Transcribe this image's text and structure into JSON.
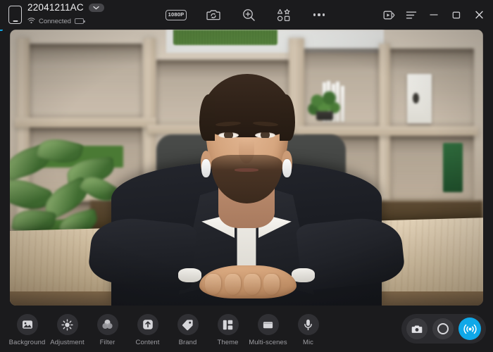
{
  "window": {
    "accent_color": "#0FA8E8",
    "background_color": "#1B1B1D"
  },
  "device": {
    "icon": "phone-icon",
    "name": "22041211AC",
    "dropdown_icon": "chevron-down-icon",
    "connection_icon": "wifi-icon",
    "connection_status": "Connected",
    "battery_icon": "battery-icon"
  },
  "toolbar": {
    "resolution_label": "1080P",
    "items": [
      {
        "name": "resolution-badge",
        "icon": "1080p-badge"
      },
      {
        "name": "flip-camera-button",
        "icon": "camera-flip-icon"
      },
      {
        "name": "zoom-button",
        "icon": "magnifier-plus-icon"
      },
      {
        "name": "effects-button",
        "icon": "shapes-grid-icon"
      },
      {
        "name": "more-options-button",
        "icon": "ellipsis-icon"
      }
    ]
  },
  "window_controls": [
    {
      "name": "export-video-button",
      "icon": "video-export-icon"
    },
    {
      "name": "menu-button",
      "icon": "hamburger-lines-icon"
    },
    {
      "name": "minimize-button",
      "icon": "minimize-icon"
    },
    {
      "name": "maximize-button",
      "icon": "maximize-icon"
    },
    {
      "name": "close-button",
      "icon": "close-icon"
    }
  ],
  "preview": {
    "description": "Live webcam preview of a bearded man in a dark suit and white shirt seated at a light wooden desk with hands clasped, wearing white earbuds, in front of a blurred wooden shelving unit with books, binders and plants"
  },
  "features": [
    {
      "label": "Background",
      "icon": "image-icon"
    },
    {
      "label": "Adjustment",
      "icon": "brightness-icon"
    },
    {
      "label": "Filter",
      "icon": "color-circles-icon"
    },
    {
      "label": "Content",
      "icon": "upload-arrow-icon"
    },
    {
      "label": "Brand",
      "icon": "tag-icon"
    },
    {
      "label": "Theme",
      "icon": "layout-blocks-icon"
    },
    {
      "label": "Multi-scenes",
      "icon": "scenes-icon"
    },
    {
      "label": "Mic",
      "icon": "microphone-icon"
    }
  ],
  "actions": [
    {
      "name": "capture-photo-button",
      "icon": "camera-icon",
      "active": false
    },
    {
      "name": "record-button",
      "icon": "record-circle-icon",
      "active": false
    },
    {
      "name": "live-stream-button",
      "icon": "broadcast-icon",
      "active": true
    }
  ]
}
